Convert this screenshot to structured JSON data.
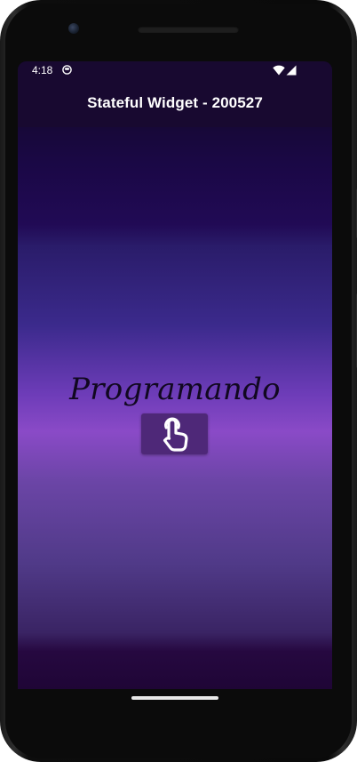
{
  "status_bar": {
    "time": "4:18"
  },
  "app_bar": {
    "title": "Stateful Widget - 200527"
  },
  "content": {
    "heading": "Programando",
    "button_icon": "touch-app-icon"
  },
  "colors": {
    "app_bar_bg": "#180930",
    "button_bg": "#4e2878",
    "gradient_mid": "#8a4ac7"
  }
}
